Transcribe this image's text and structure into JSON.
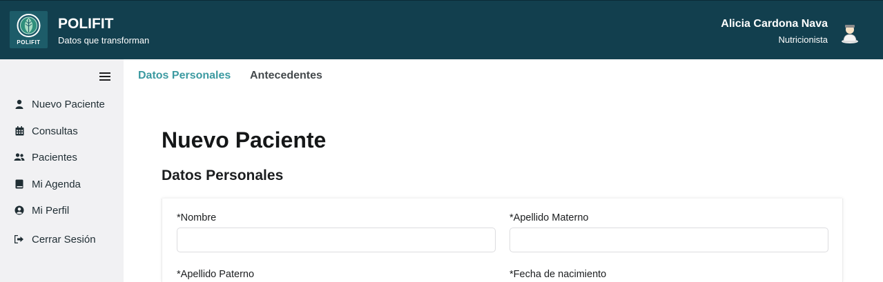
{
  "header": {
    "logo_text": "POLIFIT",
    "title": "POLIFIT",
    "subtitle": "Datos que transforman",
    "user_name": "Alicia Cardona Nava",
    "user_role": "Nutricionista"
  },
  "sidebar": {
    "items": [
      {
        "label": "Nuevo Paciente",
        "icon": "user-icon"
      },
      {
        "label": "Consultas",
        "icon": "calendar-icon"
      },
      {
        "label": "Pacientes",
        "icon": "users-icon"
      },
      {
        "label": "Mi Agenda",
        "icon": "book-icon"
      },
      {
        "label": "Mi Perfil",
        "icon": "user-circle-icon"
      },
      {
        "label": "Cerrar Sesión",
        "icon": "sign-out-icon"
      }
    ]
  },
  "tabs": [
    {
      "label": "Datos Personales",
      "active": true
    },
    {
      "label": "Antecedentes",
      "active": false
    }
  ],
  "main": {
    "page_title": "Nuevo Paciente",
    "section_title": "Datos Personales"
  },
  "form": {
    "nombre": {
      "label": "*Nombre",
      "value": ""
    },
    "apellido_materno": {
      "label": "*Apellido Materno",
      "value": ""
    },
    "apellido_paterno": {
      "label": "*Apellido Paterno"
    },
    "fecha_nacimiento": {
      "label": "*Fecha de nacimiento"
    }
  },
  "colors": {
    "header_bg": "#123f4e",
    "sidebar_bg": "#f1f1f3",
    "active_tab": "#3c9aa1"
  }
}
